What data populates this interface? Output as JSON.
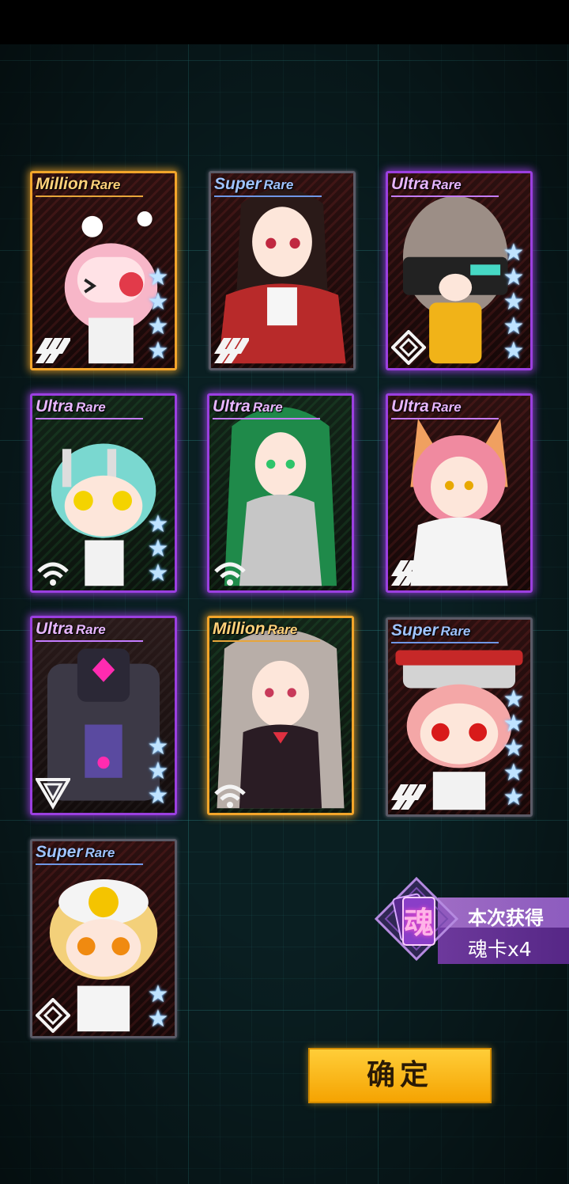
{
  "cards": [
    {
      "rarity_main": "Million",
      "rarity_suffix": "Rare",
      "tier": "million",
      "stars": 4,
      "badge": "stripe-icon",
      "bg": "red"
    },
    {
      "rarity_main": "Super",
      "rarity_suffix": "Rare",
      "tier": "super",
      "stars": 0,
      "badge": "stripe-icon",
      "bg": "red"
    },
    {
      "rarity_main": "Ultra",
      "rarity_suffix": "Rare",
      "tier": "ultra",
      "stars": 5,
      "badge": "diamond-icon",
      "bg": "red"
    },
    {
      "rarity_main": "Ultra",
      "rarity_suffix": "Rare",
      "tier": "ultra",
      "stars": 3,
      "badge": "wifi-icon",
      "bg": "green"
    },
    {
      "rarity_main": "Ultra",
      "rarity_suffix": "Rare",
      "tier": "ultra",
      "stars": 0,
      "badge": "wifi-icon",
      "bg": "green"
    },
    {
      "rarity_main": "Ultra",
      "rarity_suffix": "Rare",
      "tier": "ultra",
      "stars": 0,
      "badge": "stripe-icon",
      "bg": "red"
    },
    {
      "rarity_main": "Ultra",
      "rarity_suffix": "Rare",
      "tier": "ultra",
      "stars": 3,
      "badge": "triangle-icon",
      "bg": "purple"
    },
    {
      "rarity_main": "Million",
      "rarity_suffix": "Rare",
      "tier": "million",
      "stars": 0,
      "badge": "wifi-icon",
      "bg": "green"
    },
    {
      "rarity_main": "Super",
      "rarity_suffix": "Rare",
      "tier": "super",
      "stars": 5,
      "badge": "stripe-icon",
      "bg": "red"
    },
    {
      "rarity_main": "Super",
      "rarity_suffix": "Rare",
      "tier": "super",
      "stars": 2,
      "badge": "diamond-icon",
      "bg": "red"
    }
  ],
  "soul_card": {
    "icon_char": "魂",
    "label": "本次获得",
    "count": "魂卡x4"
  },
  "confirm_label": "确定",
  "colors": {
    "million": "#f2a52a",
    "ultra": "#9b3fe0",
    "super": "#5a5a66",
    "confirm": "#ffbf1a",
    "star": "#bfe3ff"
  }
}
